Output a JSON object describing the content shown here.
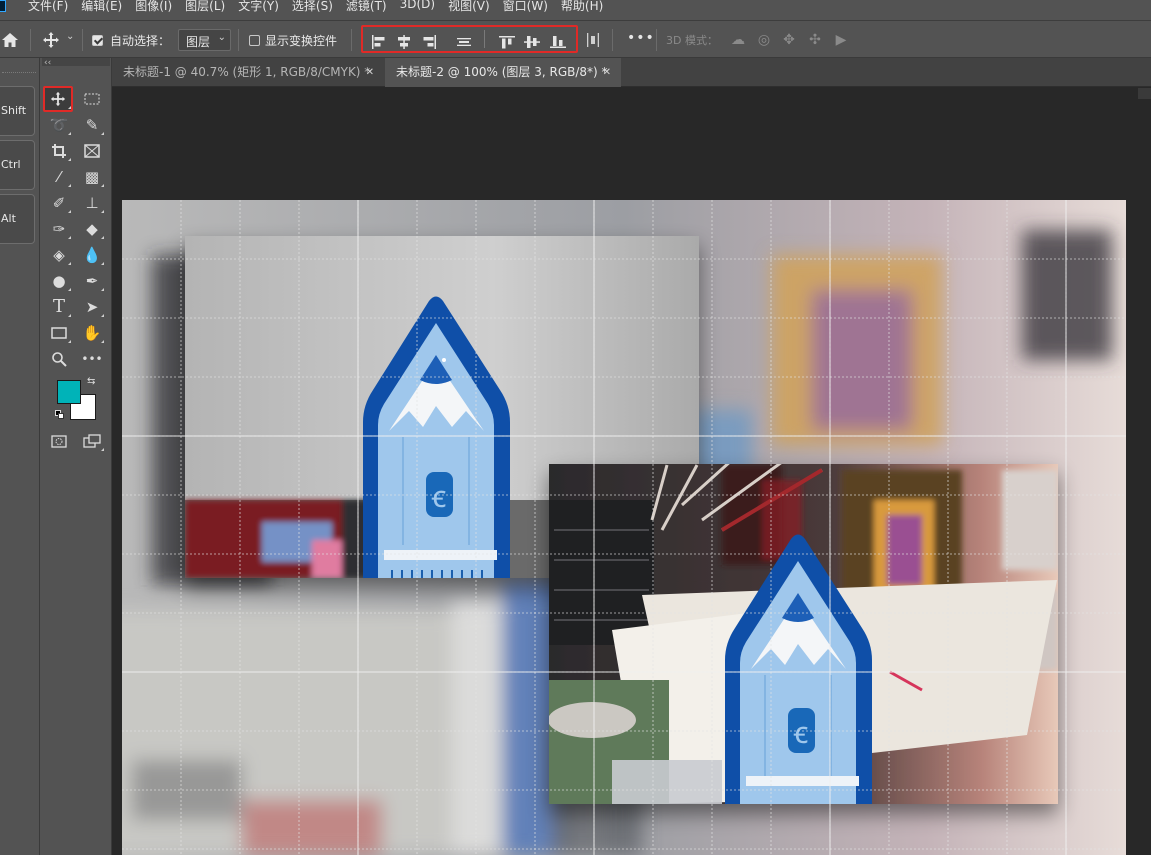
{
  "menu": {
    "items": [
      "文件(F)",
      "编辑(E)",
      "图像(I)",
      "图层(L)",
      "文字(Y)",
      "选择(S)",
      "滤镜(T)",
      "3D(D)",
      "视图(V)",
      "窗口(W)",
      "帮助(H)"
    ]
  },
  "options": {
    "auto_select_label": "自动选择：",
    "auto_select_checked": true,
    "layer_select_value": "图层",
    "show_transform_label": "显示变换控件",
    "show_transform_checked": false,
    "mode_3d_label": "3D 模式：",
    "align_icons": [
      "align-left-edges-icon",
      "align-horizontal-centers-icon",
      "align-right-edges-icon",
      "distribute-horizontal-icon",
      "align-top-edges-icon",
      "align-vertical-centers-icon",
      "align-bottom-edges-icon"
    ],
    "highlight_color": "#e02a27"
  },
  "modifiers": [
    "Shift",
    "Ctrl",
    "Alt"
  ],
  "tools": {
    "foreground_color": "#00b3b8",
    "background_color": "#ffffff"
  },
  "tabs": [
    {
      "title": "未标题-1 @ 40.7% (矩形 1, RGB/8/CMYK) *",
      "active": false
    },
    {
      "title": "未标题-2 @ 100% (图层 3, RGB/8*) *",
      "active": true
    }
  ],
  "canvas": {
    "guide_color": "#d8d8d8",
    "pencil_color": "#0f4fa8",
    "pencil_light": "#9fc7ec",
    "pencil_symbol": "ꞓ"
  }
}
